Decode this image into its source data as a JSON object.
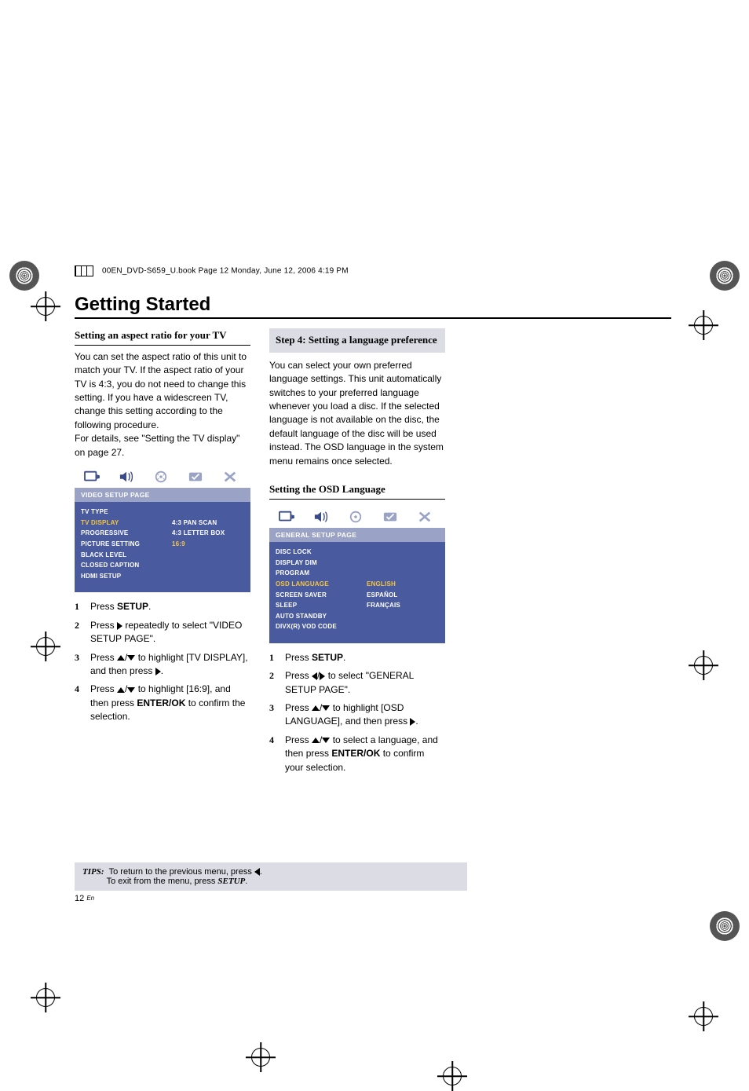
{
  "header": {
    "bookline": "00EN_DVD-S659_U.book  Page 12  Monday, June 12, 2006  4:19 PM",
    "title": "Getting Started",
    "pagenum": "12",
    "pagelang": "En"
  },
  "left": {
    "heading": "Setting an aspect ratio for your TV",
    "para1": "You can set the aspect ratio of this unit to match your TV. If the aspect ratio of your TV is 4:3, you do not need to change this setting. If you have a widescreen TV, change this setting according to the following procedure.",
    "para2": "For details, see \"Setting the TV display\" on page 27.",
    "osd": {
      "title": "VIDEO SETUP PAGE",
      "items": [
        {
          "label": "TV TYPE",
          "val": ""
        },
        {
          "label": "TV DISPLAY",
          "val": "4:3 PAN SCAN",
          "hi": true
        },
        {
          "label": "PROGRESSIVE",
          "val": "4:3 LETTER BOX"
        },
        {
          "label": "PICTURE SETTING",
          "val": "16:9",
          "valhi": true
        },
        {
          "label": "BLACK LEVEL",
          "val": ""
        },
        {
          "label": "CLOSED CAPTION",
          "val": ""
        },
        {
          "label": "HDMI SETUP",
          "val": ""
        }
      ]
    },
    "steps": {
      "s1a": "Press ",
      "s1b": "SETUP",
      "s1c": ".",
      "s2a": "Press ",
      "s2b": " repeatedly to select \"VIDEO SETUP PAGE\".",
      "s3a": "Press ",
      "s3b": " to highlight [TV DISPLAY], and then press ",
      "s3c": ".",
      "s4a": "Press ",
      "s4b": " to highlight [16:9], and then press ",
      "s4c": "ENTER/OK",
      "s4d": " to confirm the selection."
    }
  },
  "right": {
    "stepTitle": "Step 4: Setting a language preference",
    "para": "You can select your own preferred language settings. This unit automatically switches to your preferred language whenever you load a disc. If the selected language is not available on the disc, the default language of the disc will be used instead. The OSD language in the system menu remains once selected.",
    "heading": "Setting the OSD Language",
    "osd": {
      "title": "GENERAL SETUP PAGE",
      "items": [
        {
          "label": "DISC LOCK",
          "val": ""
        },
        {
          "label": "DISPLAY DIM",
          "val": ""
        },
        {
          "label": "PROGRAM",
          "val": ""
        },
        {
          "label": "OSD LANGUAGE",
          "val": "ENGLISH",
          "hi": true,
          "valhi": true
        },
        {
          "label": "SCREEN SAVER",
          "val": "ESPAÑOL"
        },
        {
          "label": "SLEEP",
          "val": "FRANÇAIS"
        },
        {
          "label": "AUTO STANDBY",
          "val": ""
        },
        {
          "label": "DIVX(R) VOD CODE",
          "val": ""
        }
      ]
    },
    "steps": {
      "s1a": "Press ",
      "s1b": "SETUP",
      "s1c": ".",
      "s2a": "Press ",
      "s2b": " to select \"GENERAL SETUP PAGE\".",
      "s3a": "Press ",
      "s3b": " to highlight [OSD LANGUAGE], and then press ",
      "s3c": ".",
      "s4a": "Press ",
      "s4b": " to select a language, and then press ",
      "s4c": "ENTER/OK",
      "s4d": " to confirm your selection."
    }
  },
  "tips": {
    "label": "TIPS:",
    "l1": "To return to the previous menu, press ",
    "l2": "To exit from the menu, press ",
    "setup": "SETUP"
  }
}
